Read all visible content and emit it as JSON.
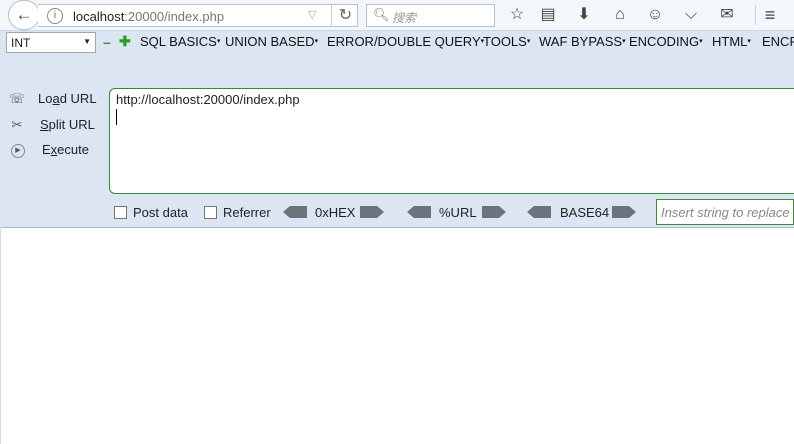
{
  "browser": {
    "url_host": "localhost",
    "url_rest": ":20000/index.php",
    "search_placeholder": "搜索",
    "toolbar_icons": [
      "star-icon",
      "clipboard-icon",
      "download-icon",
      "home-icon",
      "chat-icon",
      "pocket-icon",
      "speech-icon",
      "menu-icon"
    ]
  },
  "hackbar": {
    "type_select": "INT",
    "menus": [
      "SQL BASICS",
      "UNION BASED",
      "ERROR/DOUBLE QUERY",
      "TOOLS",
      "WAF BYPASS",
      "ENCODING",
      "HTML",
      "ENCR"
    ],
    "load_url_pre": "Lo",
    "load_url_u": "a",
    "load_url_post": "d URL",
    "split_url_u": "S",
    "split_url_post": "plit URL",
    "execute_u": "x",
    "execute_pre": "E",
    "execute_post": "ecute",
    "url_text": "http://localhost:20000/index.php",
    "post_data_label": "Post data",
    "referrer_label": "Referrer",
    "hex_label": "0xHEX",
    "url_enc_label": "%URL",
    "base64_label": "BASE64",
    "insert_placeholder": "Insert string to replace"
  }
}
